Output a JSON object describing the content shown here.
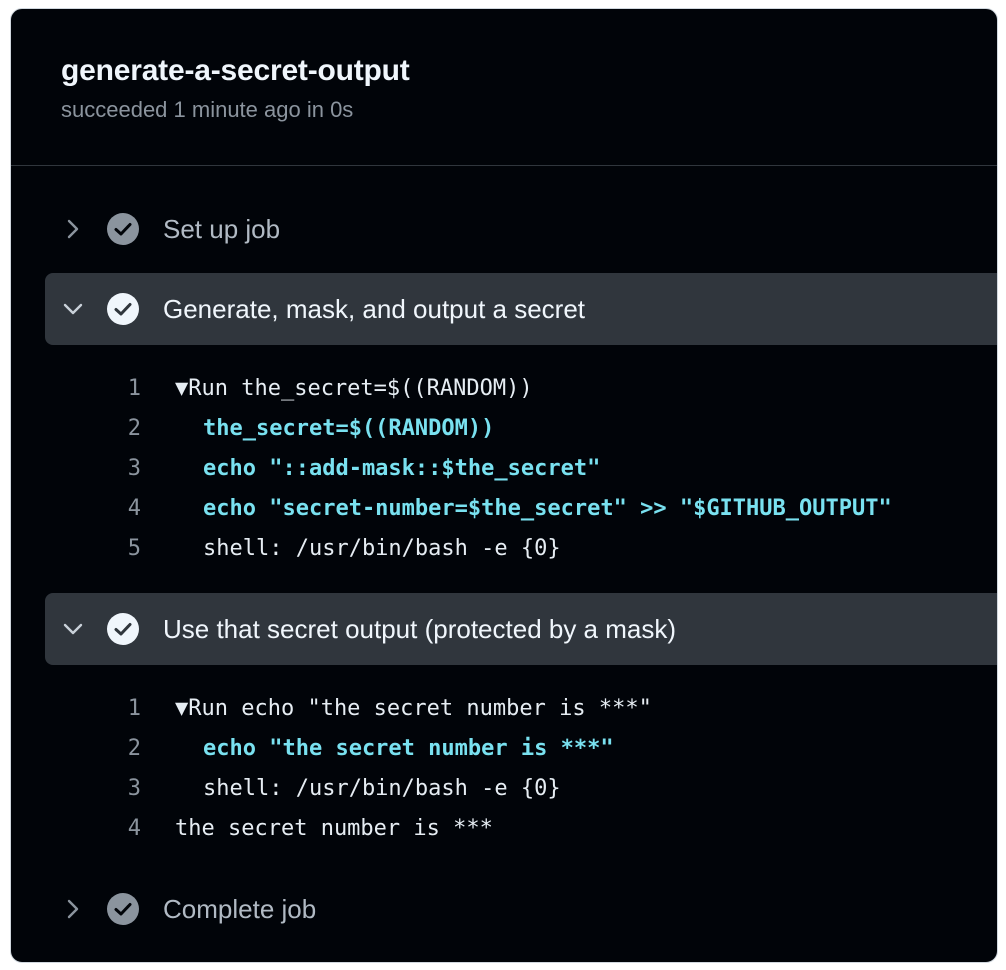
{
  "job": {
    "title": "generate-a-secret-output",
    "status": "succeeded 1 minute ago in 0s"
  },
  "steps": [
    {
      "label": "Set up job",
      "expanded": false,
      "icon": "check-circle-icon"
    },
    {
      "label": "Generate, mask, and output a secret",
      "expanded": true,
      "icon": "check-circle-icon",
      "log": [
        {
          "n": "1",
          "text": "▼Run the_secret=$((RANDOM))",
          "style": "plain"
        },
        {
          "n": "2",
          "text": "the_secret=$((RANDOM))",
          "style": "cmd"
        },
        {
          "n": "3",
          "text": "echo \"::add-mask::$the_secret\"",
          "style": "cmd"
        },
        {
          "n": "4",
          "text": "echo \"secret-number=$the_secret\" >> \"$GITHUB_OUTPUT\"",
          "style": "cmd"
        },
        {
          "n": "5",
          "text": "shell: /usr/bin/bash -e {0}",
          "style": "indent"
        }
      ]
    },
    {
      "label": "Use that secret output (protected by a mask)",
      "expanded": true,
      "icon": "check-circle-icon",
      "log": [
        {
          "n": "1",
          "text": "▼Run echo \"the secret number is ***\"",
          "style": "plain"
        },
        {
          "n": "2",
          "text": "echo \"the secret number is ***\"",
          "style": "cmd"
        },
        {
          "n": "3",
          "text": "shell: /usr/bin/bash -e {0}",
          "style": "indent"
        },
        {
          "n": "4",
          "text": "the secret number is ***",
          "style": "plain"
        }
      ]
    },
    {
      "label": "Complete job",
      "expanded": false,
      "icon": "check-circle-icon"
    }
  ],
  "colors": {
    "background": "#010409",
    "expanded_row": "#30363d",
    "command_text": "#79e1f0",
    "check_collapsed": "#8b949e",
    "check_expanded": "#f0f6fc"
  }
}
